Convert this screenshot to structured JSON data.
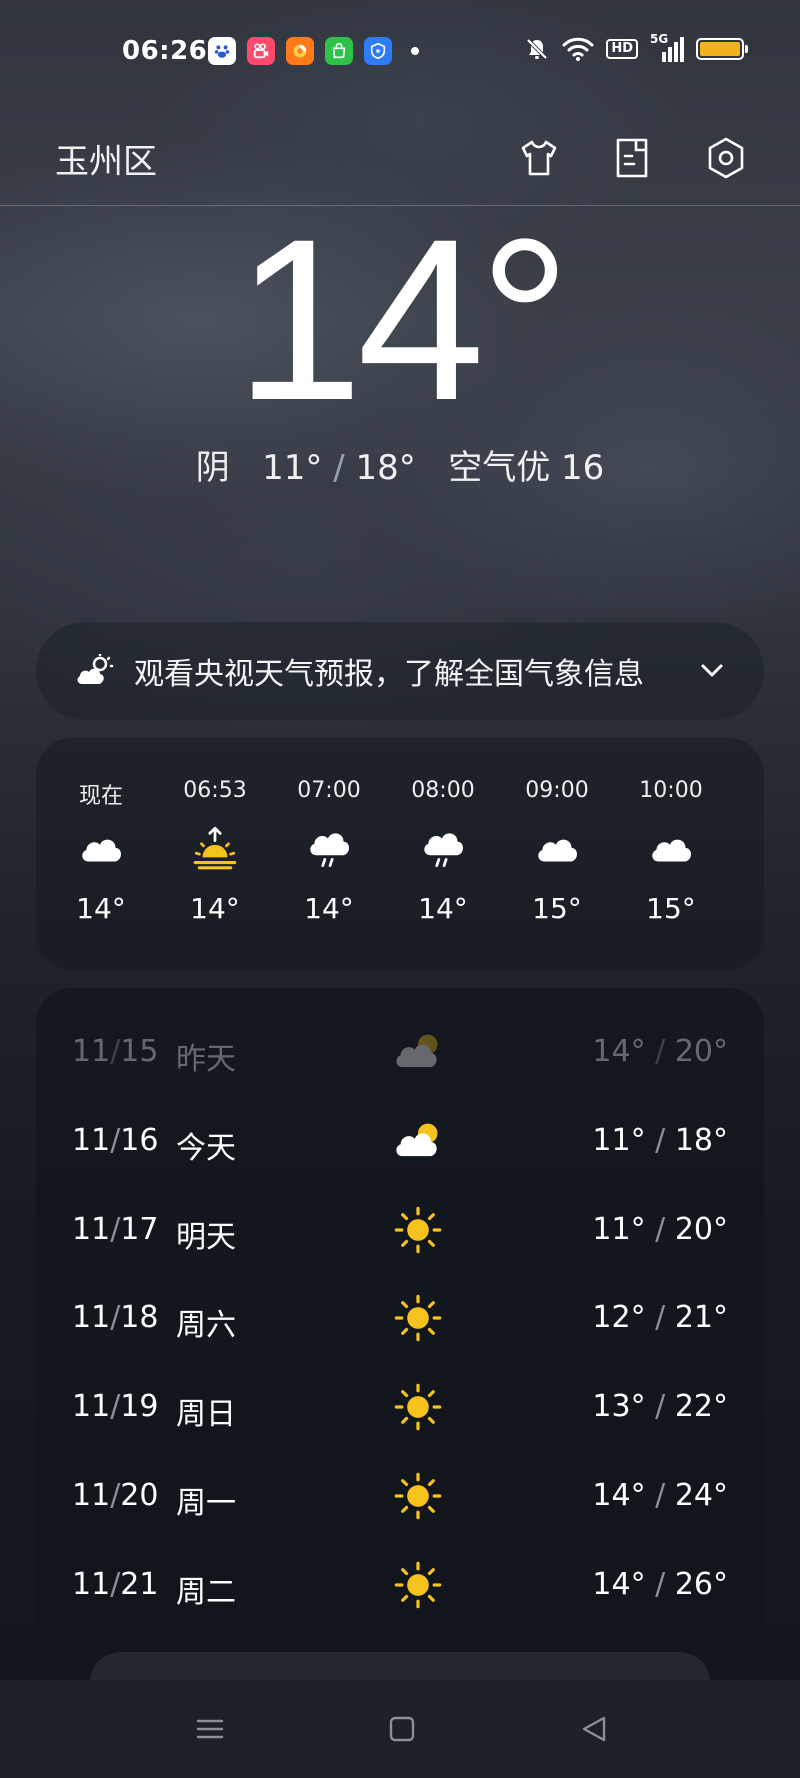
{
  "status_bar": {
    "time": "06:26",
    "hd_label": "HD",
    "network_label": "5G",
    "battery_color": "#f2b21b",
    "app_icons": [
      {
        "name": "baidu-app-icon",
        "color": "#ffffff"
      },
      {
        "name": "kuaishou-app-icon",
        "color": "#ff4a6e"
      },
      {
        "name": "firefox-app-icon",
        "color": "#ff7a1a"
      },
      {
        "name": "store-app-icon",
        "color": "#2ec24a"
      },
      {
        "name": "security-app-icon",
        "color": "#2f7df6"
      }
    ]
  },
  "header": {
    "location": "玉州区",
    "icons": [
      "shirt-icon",
      "notes-icon",
      "settings-icon"
    ]
  },
  "current": {
    "temperature": "14°",
    "condition": "阴",
    "low": "11°",
    "high": "18°",
    "separator": "/",
    "air_quality": "空气优 16"
  },
  "banner": {
    "text": "观看央视天气预报，了解全国气象信息"
  },
  "hourly": [
    {
      "time": "现在",
      "icon": "cloud-icon",
      "temp": "14°"
    },
    {
      "time": "06:53",
      "icon": "sunrise-icon",
      "temp": "14°"
    },
    {
      "time": "07:00",
      "icon": "rain-icon",
      "temp": "14°"
    },
    {
      "time": "08:00",
      "icon": "rain-icon",
      "temp": "14°"
    },
    {
      "time": "09:00",
      "icon": "cloud-icon",
      "temp": "15°"
    },
    {
      "time": "10:00",
      "icon": "cloud-icon",
      "temp": "15°"
    }
  ],
  "daily": [
    {
      "month": "11",
      "day": "15",
      "name": "昨天",
      "icon": "partly-cloudy-icon",
      "low": "14°",
      "high": "20°",
      "past": true
    },
    {
      "month": "11",
      "day": "16",
      "name": "今天",
      "icon": "partly-cloudy-icon",
      "low": "11°",
      "high": "18°",
      "past": false
    },
    {
      "month": "11",
      "day": "17",
      "name": "明天",
      "icon": "sun-icon",
      "low": "11°",
      "high": "20°",
      "past": false
    },
    {
      "month": "11",
      "day": "18",
      "name": "周六",
      "icon": "sun-icon",
      "low": "12°",
      "high": "21°",
      "past": false
    },
    {
      "month": "11",
      "day": "19",
      "name": "周日",
      "icon": "sun-icon",
      "low": "13°",
      "high": "22°",
      "past": false
    },
    {
      "month": "11",
      "day": "20",
      "name": "周一",
      "icon": "sun-icon",
      "low": "14°",
      "high": "24°",
      "past": false
    },
    {
      "month": "11",
      "day": "21",
      "name": "周二",
      "icon": "sun-icon",
      "low": "14°",
      "high": "26°",
      "past": false
    }
  ],
  "colors": {
    "sun": "#f6c21c",
    "cloud": "#ffffff"
  }
}
